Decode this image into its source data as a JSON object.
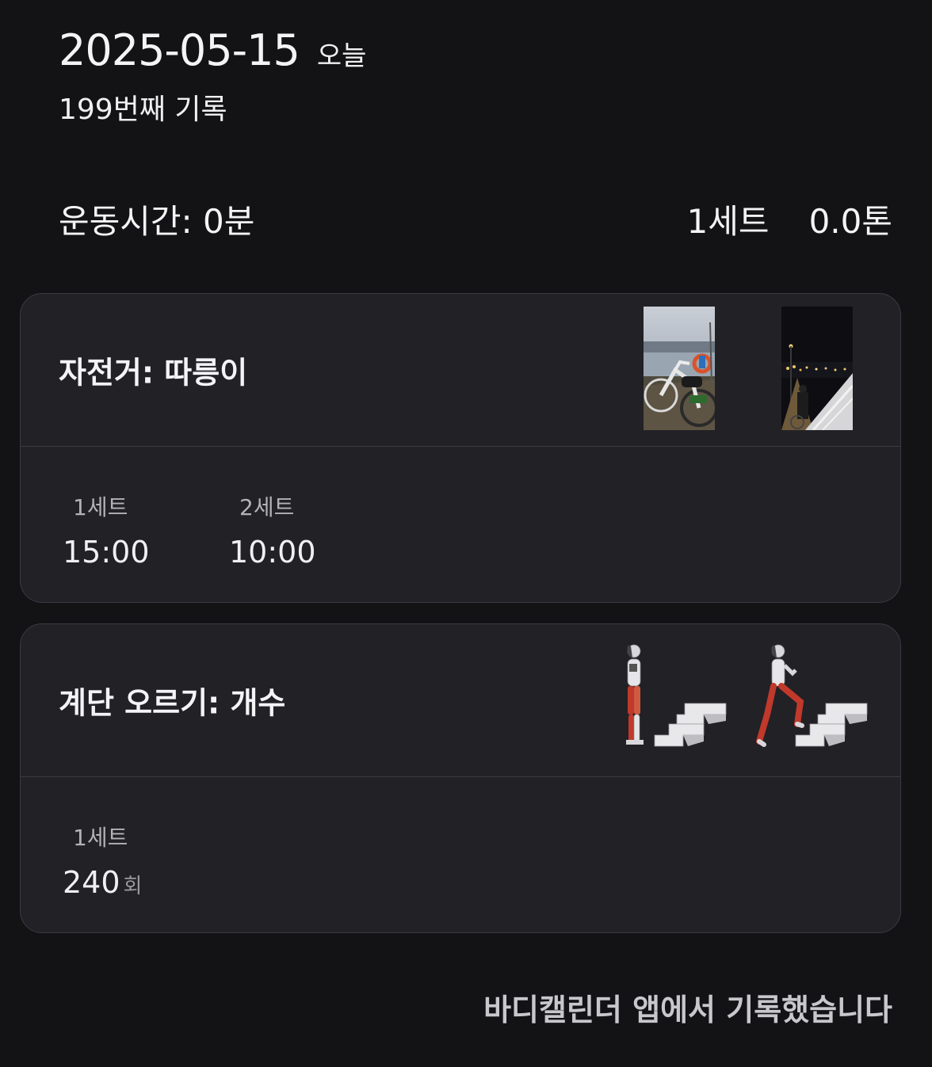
{
  "header": {
    "date": "2025-05-15",
    "today_label": "오늘",
    "record_count": "199번째 기록"
  },
  "summary": {
    "workout_time": "운동시간: 0분",
    "sets": "1세트",
    "tonnage": "0.0톤"
  },
  "exercises": [
    {
      "title": "자전거: 따릉이",
      "thumbnails": [
        "bicycle-photo",
        "night-bridge-photo"
      ],
      "sets": [
        {
          "label": "1세트",
          "value": "15:00",
          "unit": ""
        },
        {
          "label": "2세트",
          "value": "10:00",
          "unit": ""
        }
      ]
    },
    {
      "title": "계단 오르기: 개수",
      "thumbnails": [
        "stair-climb-start-illustration",
        "stair-climb-step-illustration"
      ],
      "sets": [
        {
          "label": "1세트",
          "value": "240",
          "unit": "회"
        }
      ]
    }
  ],
  "footer": {
    "text": "바디캘린더 앱에서 기록했습니다"
  },
  "colors": {
    "background": "#131316",
    "card": "#212126",
    "border": "#3a3a40",
    "muscle_highlight": "#c0392b"
  }
}
